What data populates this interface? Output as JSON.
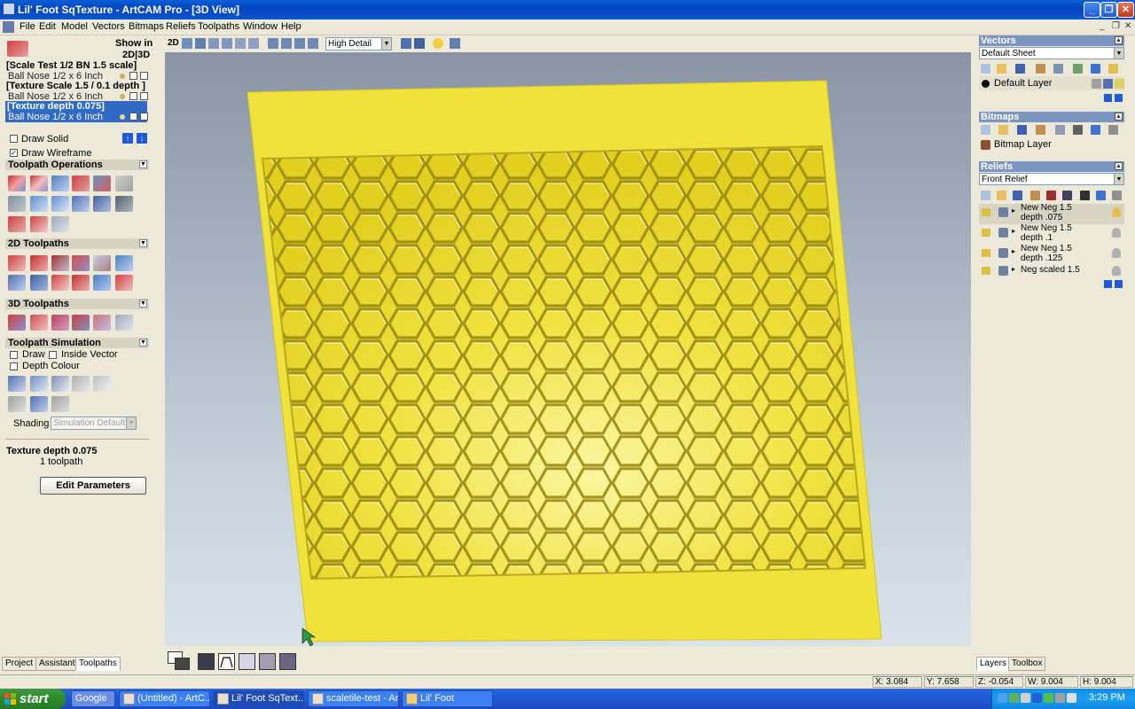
{
  "window": {
    "title": "Lil' Foot SqTexture - ArtCAM Pro - [3D View]"
  },
  "menu": [
    "File",
    "Edit",
    "Model",
    "Vectors",
    "Bitmaps",
    "Reliefs",
    "Toolpaths",
    "Window",
    "Help"
  ],
  "left": {
    "show_in": "Show in",
    "show_in_mode": "2D|3D",
    "toolpath_groups": [
      {
        "name": "[Scale Test 1/2 BN 1.5 scale]",
        "tool": "Ball Nose 1/2 x 6 Inch"
      },
      {
        "name": "[Texture Scale 1.5 / 0.1 depth ]",
        "tool": "Ball Nose 1/2 x 6 Inch"
      },
      {
        "name": "[Texture depth 0.075]",
        "tool": "Ball Nose 1/2 x 6 Inch"
      }
    ],
    "draw_solid": "Draw Solid",
    "draw_wireframe": "Draw Wireframe",
    "sec_toolpath_operations": "Toolpath Operations",
    "sec_2d_toolpaths": "2D Toolpaths",
    "sec_3d_toolpaths": "3D Toolpaths",
    "sec_toolpath_simulation": "Toolpath Simulation",
    "sim_draw": "Draw",
    "sim_inside_vector": "Inside Vector",
    "sim_depth_colour": "Depth Colour",
    "shading_label": "Shading",
    "shading_value": "Simulation Default",
    "selected_name": "Texture depth 0.075",
    "selected_count": "1 toolpath",
    "edit_button": "Edit Parameters",
    "tabs": [
      "Project",
      "Assistant",
      "Toolpaths"
    ]
  },
  "view": {
    "mode_2d": "2D",
    "detail": "High Detail"
  },
  "right": {
    "vectors_title": "Vectors",
    "vectors_sheet": "Default Sheet",
    "vectors_layer": "Default Layer",
    "bitmaps_title": "Bitmaps",
    "bitmaps_layer": "Bitmap Layer",
    "reliefs_title": "Reliefs",
    "reliefs_select": "Front Relief",
    "relief_layers": [
      {
        "line1": "New Neg 1.5",
        "line2": "depth .075"
      },
      {
        "line1": "New Neg 1.5",
        "line2": "depth .1"
      },
      {
        "line1": "New Neg 1.5",
        "line2": "depth .125"
      },
      {
        "line1": "Neg scaled 1.5",
        "line2": ""
      }
    ],
    "tabs": [
      "Layers",
      "Toolbox"
    ]
  },
  "status": {
    "x": "X: 3.084",
    "y": "Y: 7.658",
    "z": "Z: -0.054",
    "w": "W: 9.004",
    "h": "H: 9.004"
  },
  "taskbar": {
    "start": "start",
    "items": [
      "Google",
      "(Untitled) - ArtC...",
      "Lil' Foot SqText...",
      "scaletile-test - Ar...",
      "Lil' Foot"
    ],
    "clock": "3:29 PM"
  },
  "colors": {
    "relief": "#EFE03A",
    "relief_shadow": "#B8A820",
    "selection": "#316AC5"
  }
}
